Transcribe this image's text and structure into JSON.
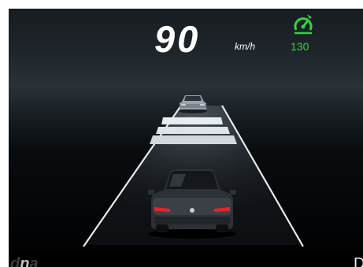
{
  "speedometer": {
    "speed": "90",
    "unit": "km/h"
  },
  "cruise_control": {
    "icon": "speedometer-cruise-icon",
    "set_speed": "130",
    "color": "#2fd63a"
  },
  "adas": {
    "lanes": "lane-guides",
    "lead_vehicle": "car-far",
    "own_vehicle": "car-near",
    "following_distance_bars": 3
  },
  "footer": {
    "dna_d": "d",
    "dna_n": "n",
    "dna_a": "a",
    "drive_mode": "D"
  }
}
